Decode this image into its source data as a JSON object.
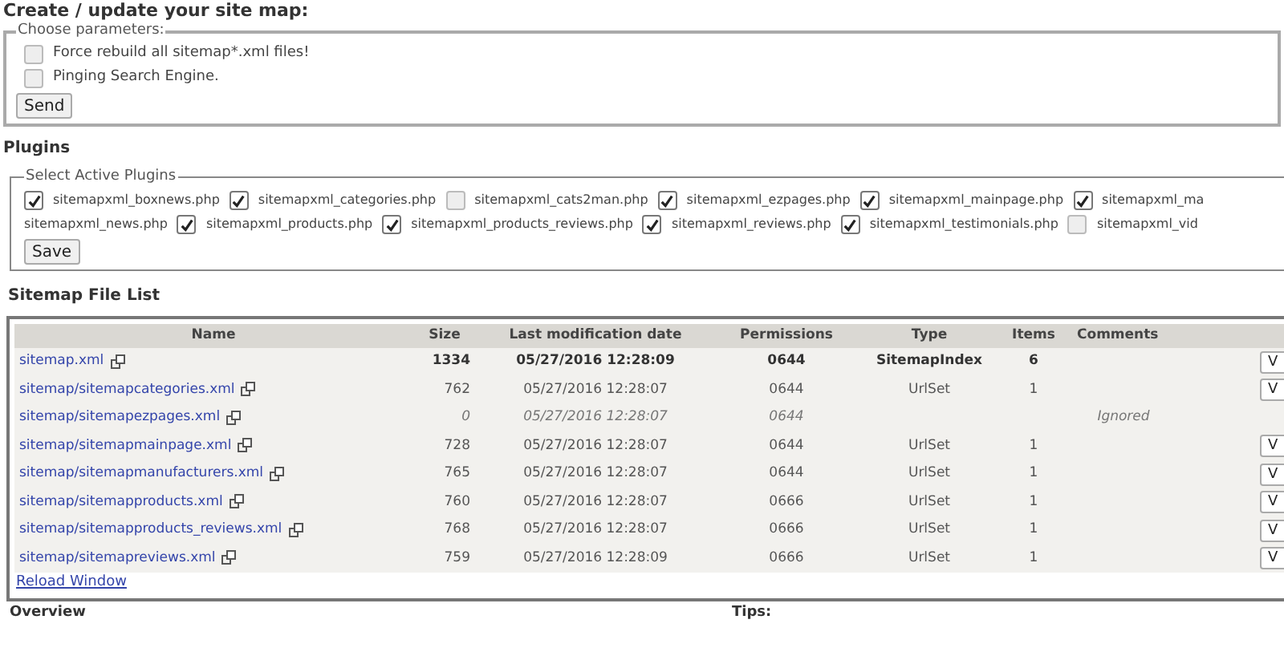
{
  "title": "Create / update your site map:",
  "parameters": {
    "legend": "Choose parameters:",
    "options": [
      {
        "label": "Force rebuild all sitemap*.xml files!",
        "checked": false
      },
      {
        "label": "Pinging Search Engine.",
        "checked": false
      }
    ],
    "button": "Send"
  },
  "plugins": {
    "heading": "Plugins",
    "legend": "Select Active Plugins",
    "lines": [
      [
        {
          "label": "sitemapxml_boxnews.php",
          "checked": true
        },
        {
          "label": "sitemapxml_categories.php",
          "checked": true
        },
        {
          "label": "sitemapxml_cats2man.php",
          "checked": false
        },
        {
          "label": "sitemapxml_ezpages.php",
          "checked": true
        },
        {
          "label": "sitemapxml_mainpage.php",
          "checked": true
        },
        {
          "label": "sitemapxml_ma",
          "checked": true
        }
      ],
      [
        {
          "label": "sitemapxml_news.php"
        },
        {
          "label": "sitemapxml_products.php",
          "checked": true
        },
        {
          "label": "sitemapxml_products_reviews.php",
          "checked": true
        },
        {
          "label": "sitemapxml_reviews.php",
          "checked": true
        },
        {
          "label": "sitemapxml_testimonials.php",
          "checked": true
        },
        {
          "label": "sitemapxml_vid",
          "checked": false
        }
      ]
    ],
    "button": "Save"
  },
  "file_list": {
    "heading": "Sitemap File List",
    "columns": [
      "Name",
      "Size",
      "Last modification date",
      "Permissions",
      "Type",
      "Items",
      "Comments"
    ],
    "rows": [
      {
        "kind": "index",
        "name": "sitemap.xml",
        "size": "1334",
        "date": "05/27/2016 12:28:09",
        "permissions": "0644",
        "type": "SitemapIndex",
        "items": "6",
        "button": "V"
      },
      {
        "kind": "set",
        "name": "sitemap/sitemapcategories.xml",
        "size": "762",
        "date": "05/27/2016 12:28:07",
        "permissions": "0644",
        "type": "UrlSet",
        "items": "1",
        "button": "V"
      },
      {
        "kind": "ignored",
        "name": "sitemap/sitemapezpages.xml",
        "size": "0",
        "date": "05/27/2016 12:28:07",
        "permissions": "0644",
        "comment": "Ignored"
      },
      {
        "kind": "set",
        "name": "sitemap/sitemapmainpage.xml",
        "size": "728",
        "date": "05/27/2016 12:28:07",
        "permissions": "0644",
        "type": "UrlSet",
        "items": "1",
        "button": "V"
      },
      {
        "kind": "set",
        "name": "sitemap/sitemapmanufacturers.xml",
        "size": "765",
        "date": "05/27/2016 12:28:07",
        "permissions": "0644",
        "type": "UrlSet",
        "items": "1",
        "button": "V"
      },
      {
        "kind": "set",
        "name": "sitemap/sitemapproducts.xml",
        "size": "760",
        "date": "05/27/2016 12:28:07",
        "permissions": "0666",
        "type": "UrlSet",
        "items": "1",
        "button": "V"
      },
      {
        "kind": "set",
        "name": "sitemap/sitemapproducts_reviews.xml",
        "size": "768",
        "date": "05/27/2016 12:28:07",
        "permissions": "0666",
        "type": "UrlSet",
        "items": "1",
        "button": "V"
      },
      {
        "kind": "set",
        "name": "sitemap/sitemapreviews.xml",
        "size": "759",
        "date": "05/27/2016 12:28:09",
        "permissions": "0666",
        "type": "UrlSet",
        "items": "1",
        "button": "V"
      }
    ],
    "reload": "Reload Window"
  },
  "footer": [
    "Overview",
    "Tips:"
  ]
}
